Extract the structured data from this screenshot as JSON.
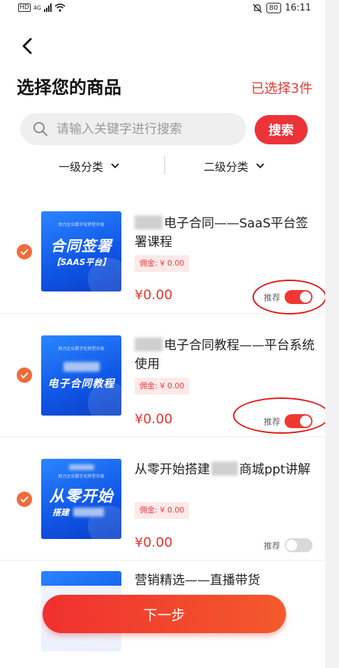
{
  "status_bar": {
    "left": "HD",
    "signal": "4G",
    "battery": "80",
    "time": "16:11"
  },
  "header": {
    "title": "选择您的商品",
    "selected_count": "已选择3件"
  },
  "search": {
    "placeholder": "请输入关键字进行搜索",
    "button": "搜索"
  },
  "filters": {
    "level1": "一级分类",
    "level2": "二级分类"
  },
  "products": [
    {
      "name": "电子合同——SaaS平台签署课程",
      "commission": "佣金: ¥ 0.00",
      "price": "¥0.00",
      "recommend_label": "推荐",
      "recommend": true,
      "checked": true,
      "thumb_top": "助力企业数字化转型升级",
      "thumb_big": "合同签署",
      "thumb_small": "【SAAS平台】"
    },
    {
      "name": "电子合同教程——平台系统使用",
      "commission": "佣金: ¥ 0.00",
      "price": "¥0.00",
      "recommend_label": "推荐",
      "recommend": true,
      "checked": true,
      "thumb_top": "助力企业数字化转型升级",
      "thumb_big": "电子合同教程",
      "thumb_small": ""
    },
    {
      "name": "从零开始搭建商城ppt讲解",
      "name_part1": "从零开始搭建",
      "name_part2": "商城ppt讲解",
      "commission": "佣金: ¥ 0.00",
      "price": "¥0.00",
      "recommend_label": "推荐",
      "recommend": false,
      "checked": true,
      "thumb_top": "助力企业数字化转型升级",
      "thumb_big": "从零开始",
      "thumb_small": "搭建"
    },
    {
      "name": "营销精选——直播带货"
    }
  ],
  "footer": {
    "next_button": "下一步"
  },
  "colors": {
    "accent": "#ec3338",
    "check": "#f26b3a",
    "price": "#e53935"
  }
}
